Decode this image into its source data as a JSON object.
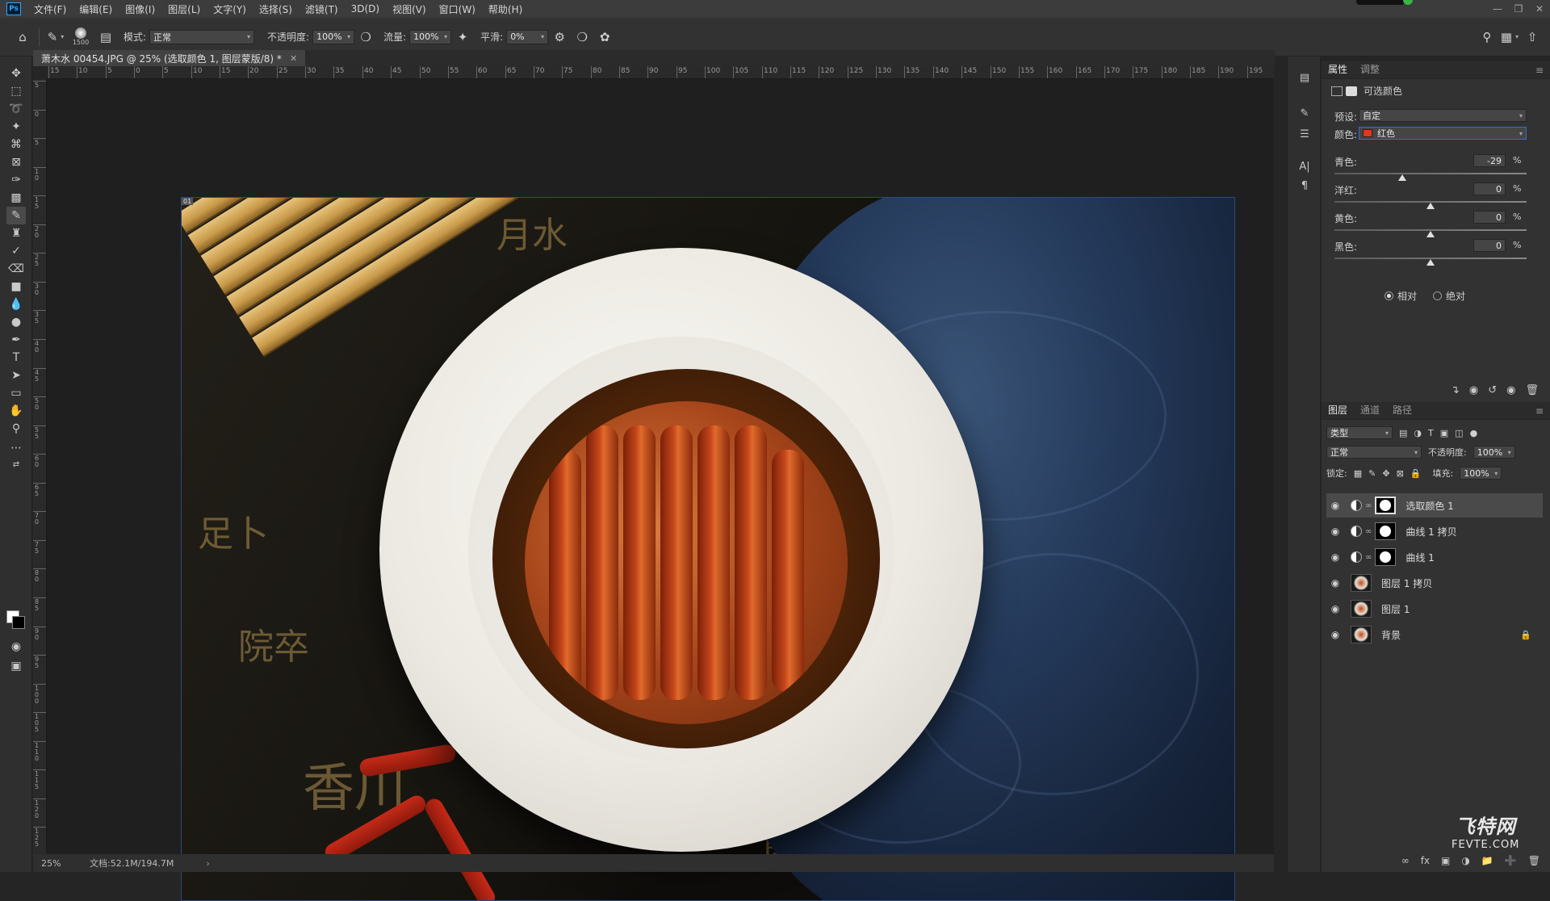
{
  "menu": {
    "items": [
      "文件(F)",
      "编辑(E)",
      "图像(I)",
      "图层(L)",
      "文字(Y)",
      "选择(S)",
      "滤镜(T)",
      "3D(D)",
      "视图(V)",
      "窗口(W)",
      "帮助(H)"
    ]
  },
  "options": {
    "brush_size": "1500",
    "mode_label": "模式:",
    "mode_value": "正常",
    "opacity_label": "不透明度:",
    "opacity_value": "100%",
    "flow_label": "流量:",
    "flow_value": "100%",
    "smooth_label": "平滑:",
    "smooth_value": "0%"
  },
  "document": {
    "tab_title": "萧木水 00454.JPG @ 25% (选取颜色 1, 图层蒙版/8) *",
    "zoom": "25%",
    "doc_info": "文档:52.1M/194.7M"
  },
  "ruler": {
    "top_labels": [
      "15",
      "10",
      "5",
      "0",
      "5",
      "10",
      "15",
      "20",
      "25",
      "30",
      "35",
      "40",
      "45",
      "50",
      "55",
      "60",
      "65",
      "70",
      "75",
      "80",
      "85",
      "90",
      "95",
      "100",
      "105",
      "110",
      "115",
      "120",
      "125",
      "130",
      "135",
      "140",
      "145",
      "150",
      "155",
      "160",
      "165",
      "170",
      "175",
      "180",
      "185",
      "190",
      "195"
    ],
    "left_labels": [
      "5",
      "0",
      "5",
      "1 0",
      "1 5",
      "2 0",
      "2 5",
      "3 0",
      "3 5",
      "4 0",
      "4 5",
      "5 0",
      "5 5",
      "6 0",
      "6 5",
      "7 0",
      "7 5",
      "8 0",
      "8 5",
      "9 0",
      "9 5",
      "1 0 0",
      "1 0 5",
      "1 1 0",
      "1 1 5",
      "1 2 0",
      "1 2 5"
    ]
  },
  "properties": {
    "tabs": [
      "属性",
      "调整"
    ],
    "title": "可选颜色",
    "preset_label": "预设:",
    "preset_value": "自定",
    "color_label": "颜色:",
    "color_value": "红色",
    "sliders": [
      {
        "label": "青色:",
        "value": "-29",
        "unit": "%",
        "level": -29
      },
      {
        "label": "洋红:",
        "value": "0",
        "unit": "%",
        "level": 0
      },
      {
        "label": "黄色:",
        "value": "0",
        "unit": "%",
        "level": 0
      },
      {
        "label": "黑色:",
        "value": "0",
        "unit": "%",
        "level": 0
      }
    ],
    "method_relative": "相对",
    "method_absolute": "绝对"
  },
  "layers": {
    "tabs": [
      "图层",
      "通道",
      "路径"
    ],
    "filter_label": "类型",
    "blend_mode": "正常",
    "opacity_label": "不透明度:",
    "opacity_value": "100%",
    "lock_label": "锁定:",
    "fill_label": "填充:",
    "fill_value": "100%",
    "items": [
      {
        "name": "选取颜色 1",
        "kind": "adjustment"
      },
      {
        "name": "曲线 1 拷贝",
        "kind": "adjustment"
      },
      {
        "name": "曲线 1",
        "kind": "adjustment"
      },
      {
        "name": "图层 1 拷贝",
        "kind": "image"
      },
      {
        "name": "图层 1",
        "kind": "image"
      },
      {
        "name": "背景",
        "kind": "image"
      }
    ]
  },
  "watermark": {
    "line1": "飞特网",
    "line2": "FEVTE.COM"
  },
  "image": {
    "indicator": "01"
  }
}
